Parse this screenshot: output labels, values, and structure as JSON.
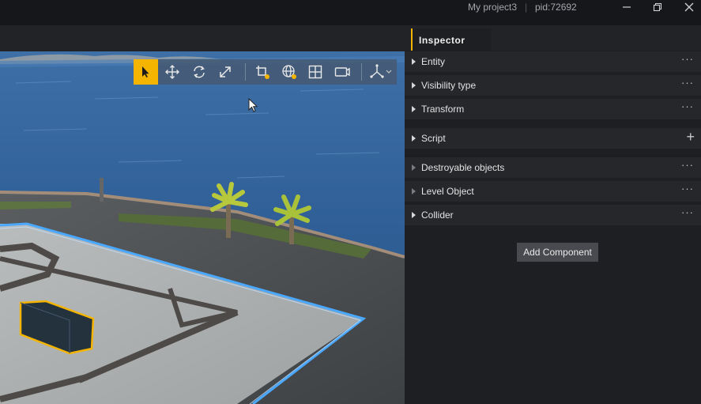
{
  "titlebar": {
    "project": "My project3",
    "separator": "|",
    "pid": "pid:72692"
  },
  "viewport": {
    "toolbar": {
      "buttons": [
        {
          "name": "select-tool",
          "icon": "cursor-arrow-icon",
          "active": true
        },
        {
          "name": "move-tool",
          "icon": "move-arrows-icon"
        },
        {
          "name": "rotate-tool",
          "icon": "rotate-icon"
        },
        {
          "name": "scale-tool",
          "icon": "scale-diagonal-icon"
        },
        {
          "name": "snap-tool",
          "icon": "snap-grid-icon"
        },
        {
          "name": "world-local-toggle",
          "icon": "globe-icon"
        },
        {
          "name": "layout-tool",
          "icon": "layout-grid-icon"
        },
        {
          "name": "camera-tool",
          "icon": "camera-icon"
        },
        {
          "name": "axis-dropdown",
          "icon": "axis-gizmo-icon"
        }
      ]
    }
  },
  "inspector": {
    "tab_label": "Inspector",
    "components": [
      {
        "label": "Entity",
        "action": "···"
      },
      {
        "label": "Visibility type",
        "action": "···"
      },
      {
        "label": "Transform",
        "action": "···"
      },
      {
        "label": "Script",
        "action": "+"
      },
      {
        "label": "Destroyable objects",
        "action": "···"
      },
      {
        "label": "Level Object",
        "action": "···"
      },
      {
        "label": "Collider",
        "action": "···"
      }
    ],
    "add_component_label": "Add Component"
  },
  "colors": {
    "accent": "#f4b400",
    "panel_bg": "#1e1f22",
    "row_bg": "#26272b",
    "glow": "#4aa8ff"
  }
}
